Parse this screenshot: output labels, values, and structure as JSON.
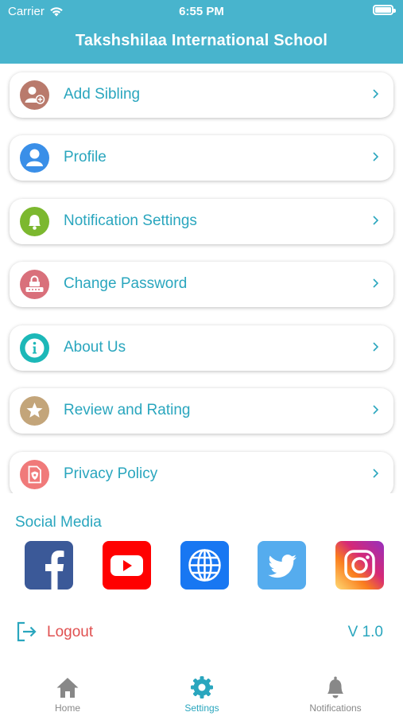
{
  "status": {
    "carrier": "Carrier",
    "time": "6:55 PM"
  },
  "header": {
    "title": "Takshshilaa International School"
  },
  "menu": [
    {
      "label": "Add Sibling",
      "icon": "add-user-icon",
      "color": "#b97a6c"
    },
    {
      "label": "Profile",
      "icon": "person-icon",
      "color": "#3a8fe8"
    },
    {
      "label": "Notification Settings",
      "icon": "bell-icon",
      "color": "#7cb82f"
    },
    {
      "label": "Change Password",
      "icon": "lock-icon",
      "color": "#d9707b"
    },
    {
      "label": "About Us",
      "icon": "info-icon",
      "color": "#1cb8b8"
    },
    {
      "label": "Review and Rating",
      "icon": "star-icon",
      "color": "#c3a57a"
    },
    {
      "label": "Privacy Policy",
      "icon": "shield-document-icon",
      "color": "#f07a7a"
    }
  ],
  "social": {
    "title": "Social Media",
    "items": [
      {
        "name": "facebook-icon",
        "color": "#3b5998"
      },
      {
        "name": "youtube-icon",
        "color": "#ff0000"
      },
      {
        "name": "website-globe-icon",
        "color": "#1877f2"
      },
      {
        "name": "twitter-icon",
        "color": "#55acee"
      },
      {
        "name": "instagram-icon",
        "color": "#e1306c"
      }
    ]
  },
  "logout_label": "Logout",
  "version": "V 1.0",
  "tabs": [
    {
      "label": "Home",
      "icon": "home-icon",
      "active": false
    },
    {
      "label": "Settings",
      "icon": "gear-icon",
      "active": true
    },
    {
      "label": "Notifications",
      "icon": "bell-icon",
      "active": false
    }
  ],
  "colors": {
    "header": "#48b4cd",
    "accent": "#2aa6be",
    "logout": "#e05050",
    "inactive": "#888888"
  }
}
